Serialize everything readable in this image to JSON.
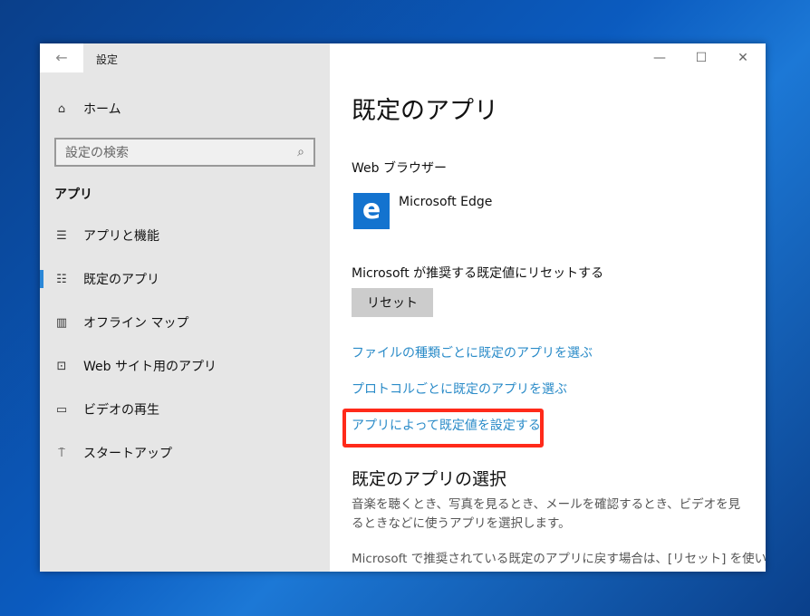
{
  "window": {
    "title": "設定",
    "controls": [
      "minimize",
      "maximize",
      "close"
    ]
  },
  "sidebar": {
    "home": "ホーム",
    "search_placeholder": "設定の検索",
    "section": "アプリ",
    "items": [
      {
        "label": "アプリと機能",
        "icon": "list-icon"
      },
      {
        "label": "既定のアプリ",
        "icon": "default-apps-icon",
        "selected": true
      },
      {
        "label": "オフライン マップ",
        "icon": "map-download-icon"
      },
      {
        "label": "Web サイト用のアプリ",
        "icon": "web-link-icon"
      },
      {
        "label": "ビデオの再生",
        "icon": "video-icon"
      },
      {
        "label": "スタートアップ",
        "icon": "startup-icon"
      }
    ]
  },
  "main": {
    "title": "既定のアプリ",
    "browser_label": "Web ブラウザー",
    "browser_app": "Microsoft Edge",
    "reset_label": "Microsoft が推奨する既定値にリセットする",
    "reset_button": "リセット",
    "links": [
      "ファイルの種類ごとに既定のアプリを選ぶ",
      "プロトコルごとに既定のアプリを選ぶ",
      "アプリによって既定値を設定する"
    ],
    "choose_title": "既定のアプリの選択",
    "choose_desc": "音楽を聴くとき、写真を見るとき、メールを確認するとき、ビデオを見るときなどに使うアプリを選択します。",
    "reset_desc": "Microsoft で推奨されている既定のアプリに戻す場合は、[リセット] を使い"
  },
  "colors": {
    "accent": "#2b88d8",
    "link": "#2a8bc8",
    "highlight": "#ff2a1a"
  }
}
